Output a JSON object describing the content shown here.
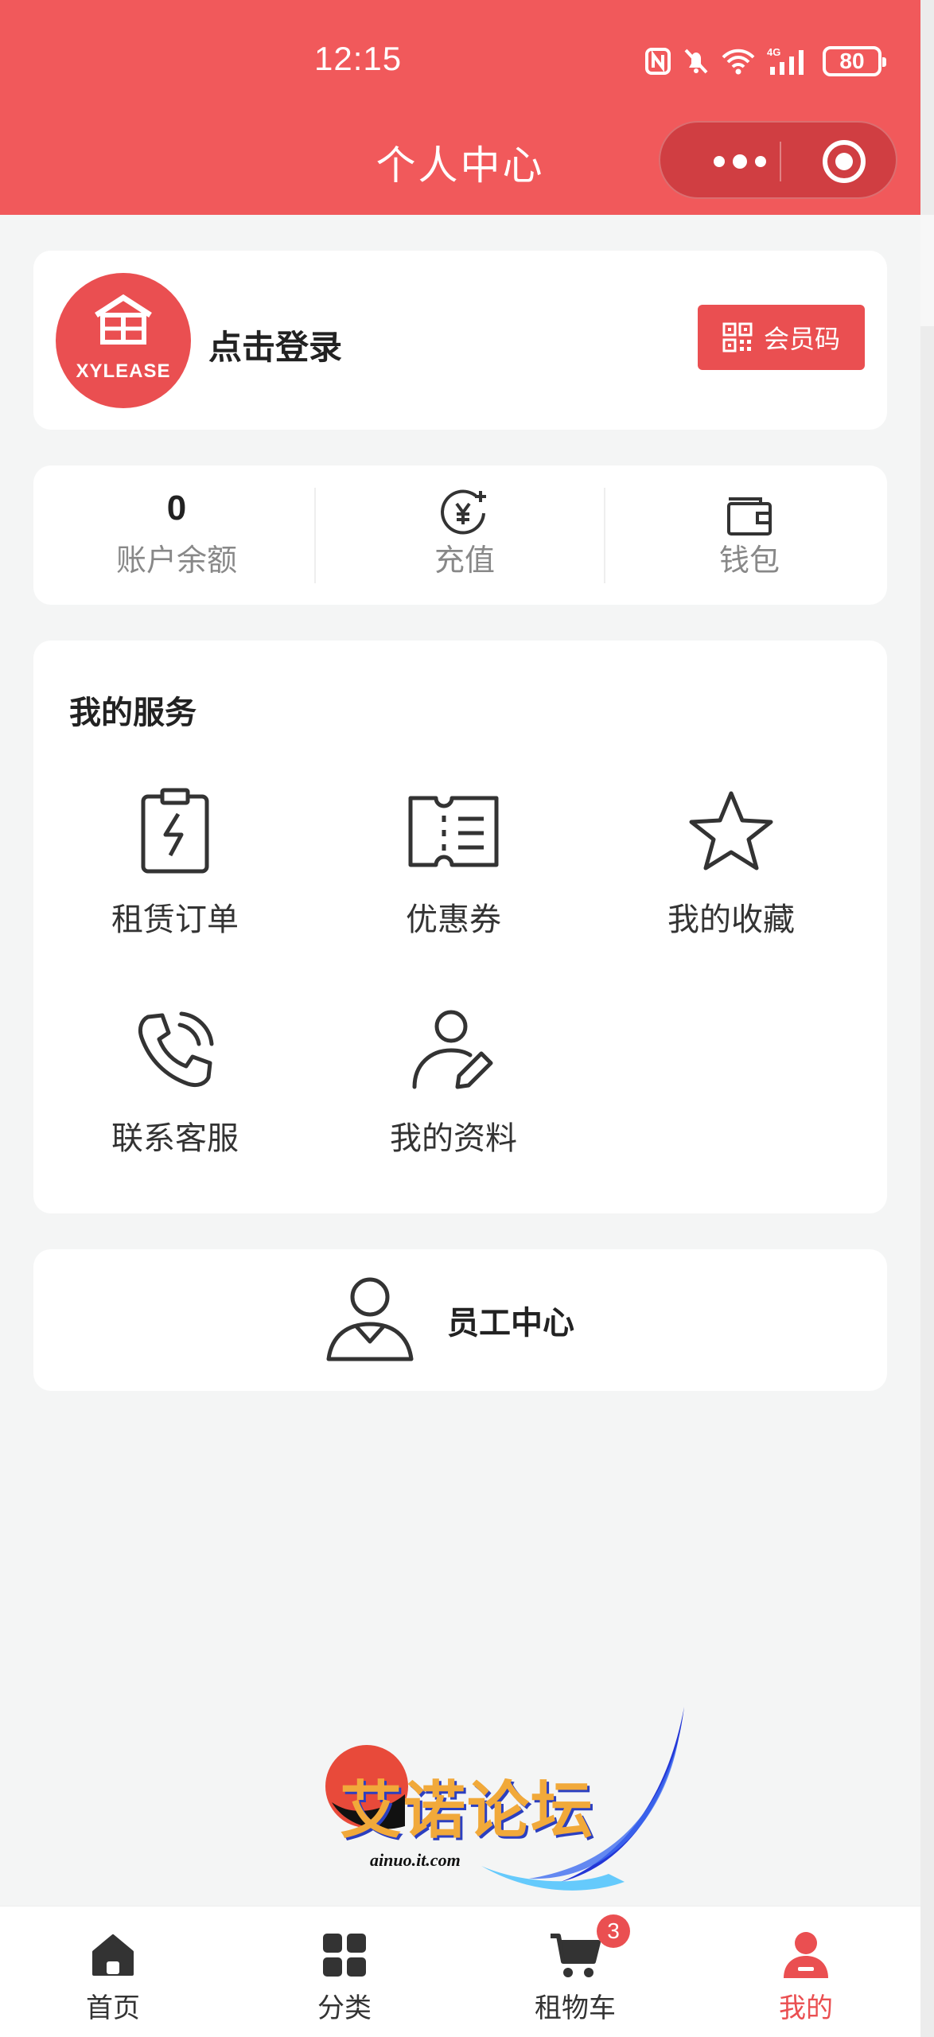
{
  "status_bar": {
    "time": "12:15",
    "battery": "80"
  },
  "nav": {
    "title": "个人中心"
  },
  "profile": {
    "avatar_logo_text": "XYLEASE",
    "login_label": "点击登录",
    "member_code_label": "会员码"
  },
  "balance": {
    "amount": "0",
    "amount_label": "账户余额",
    "recharge_label": "充值",
    "wallet_label": "钱包"
  },
  "services": {
    "title": "我的服务",
    "items": [
      {
        "label": "租赁订单",
        "icon": "clipboard-bolt-icon"
      },
      {
        "label": "优惠券",
        "icon": "ticket-icon"
      },
      {
        "label": "我的收藏",
        "icon": "star-icon"
      },
      {
        "label": "联系客服",
        "icon": "phone-call-icon"
      },
      {
        "label": "我的资料",
        "icon": "user-edit-icon"
      }
    ]
  },
  "staff": {
    "label": "员工中心"
  },
  "watermark": {
    "text": "艾诺论坛",
    "url": "ainuo.it.com"
  },
  "tabbar": {
    "items": [
      {
        "label": "首页",
        "icon": "home-icon"
      },
      {
        "label": "分类",
        "icon": "grid-icon"
      },
      {
        "label": "租物车",
        "icon": "cart-icon",
        "badge": "3"
      },
      {
        "label": "我的",
        "icon": "user-icon",
        "active": true
      }
    ]
  },
  "colors": {
    "brand": "#f1595b",
    "accent": "#ea4f51",
    "background": "#f4f5f5"
  }
}
